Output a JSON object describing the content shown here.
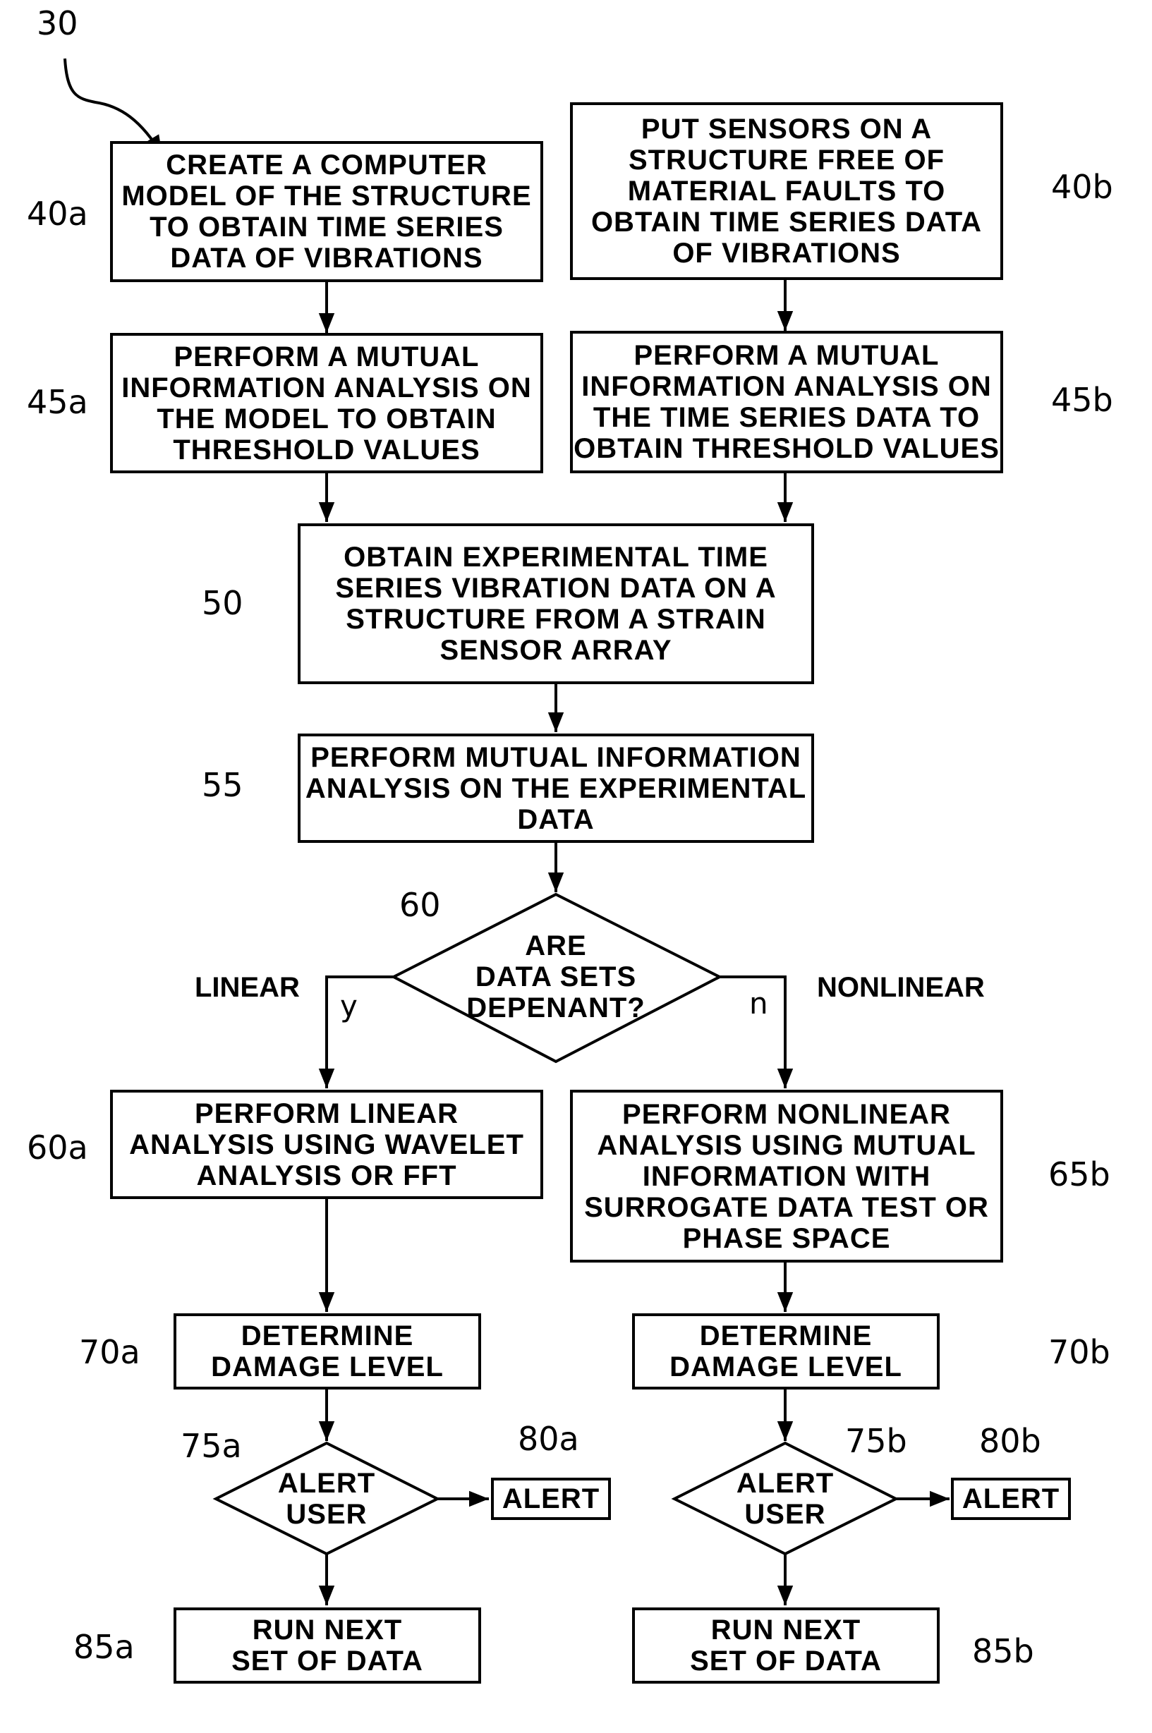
{
  "figure_ref": "30",
  "boxes": {
    "b40a": {
      "ref": "40a",
      "text": "CREATE A COMPUTER\nMODEL OF THE STRUCTURE\nTO OBTAIN TIME SERIES\nDATA OF VIBRATIONS"
    },
    "b40b": {
      "ref": "40b",
      "text": "PUT SENSORS ON A\nSTRUCTURE FREE OF\nMATERIAL FAULTS TO\nOBTAIN TIME SERIES DATA\nOF VIBRATIONS"
    },
    "b45a": {
      "ref": "45a",
      "text": "PERFORM A MUTUAL\nINFORMATION ANALYSIS ON\nTHE MODEL TO OBTAIN\nTHRESHOLD VALUES"
    },
    "b45b": {
      "ref": "45b",
      "text": "PERFORM A MUTUAL\nINFORMATION ANALYSIS ON\nTHE TIME SERIES DATA TO\nOBTAIN THRESHOLD VALUES"
    },
    "b50": {
      "ref": "50",
      "text": "OBTAIN EXPERIMENTAL TIME\nSERIES VIBRATION DATA ON A\nSTRUCTURE FROM A STRAIN\nSENSOR ARRAY"
    },
    "b55": {
      "ref": "55",
      "text": "PERFORM MUTUAL INFORMATION\nANALYSIS ON THE EXPERIMENTAL\nDATA"
    },
    "b60a": {
      "ref": "60a",
      "text": "PERFORM LINEAR\nANALYSIS USING WAVELET\nANALYSIS OR FFT"
    },
    "b65b": {
      "ref": "65b",
      "text": "PERFORM NONLINEAR\nANALYSIS USING MUTUAL\nINFORMATION WITH\nSURROGATE DATA TEST OR\nPHASE SPACE"
    },
    "b70a": {
      "ref": "70a",
      "text": "DETERMINE\nDAMAGE LEVEL"
    },
    "b70b": {
      "ref": "70b",
      "text": "DETERMINE\nDAMAGE LEVEL"
    },
    "b80a": {
      "ref": "80a",
      "text": "ALERT"
    },
    "b80b": {
      "ref": "80b",
      "text": "ALERT"
    },
    "b85a": {
      "ref": "85a",
      "text": "RUN NEXT\nSET OF DATA"
    },
    "b85b": {
      "ref": "85b",
      "text": "RUN NEXT\nSET OF DATA"
    }
  },
  "decisions": {
    "d60": {
      "ref": "60",
      "text": "ARE\nDATA SETS\nDEPENANT?",
      "yes_label": "y",
      "no_label": "n",
      "left_branch": "LINEAR",
      "right_branch": "NONLINEAR"
    },
    "d75a": {
      "ref": "75a",
      "text": "ALERT\nUSER"
    },
    "d75b": {
      "ref": "75b",
      "text": "ALERT\nUSER"
    }
  }
}
